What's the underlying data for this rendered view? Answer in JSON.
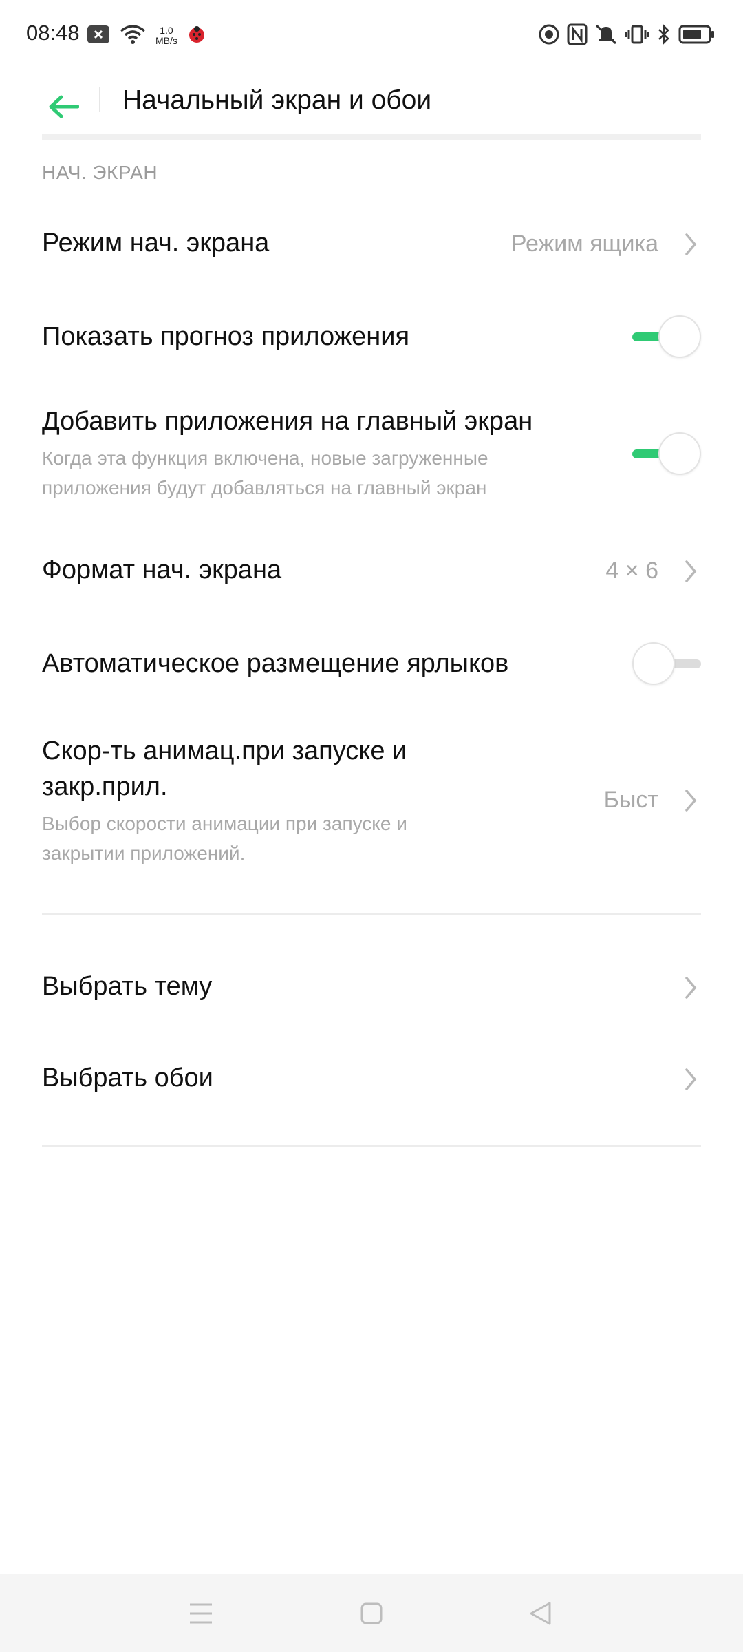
{
  "status_bar": {
    "time": "08:48",
    "speed_value": "1.0",
    "speed_unit": "MB/s"
  },
  "header": {
    "title": "Начальный экран и обои"
  },
  "section": {
    "home_screen": "НАЧ. ЭКРАН"
  },
  "rows": {
    "home_mode": {
      "title": "Режим нач. экрана",
      "value": "Режим ящика"
    },
    "app_prediction": {
      "title": "Показать прогноз приложения",
      "enabled": true
    },
    "add_apps": {
      "title": "Добавить приложения на главный экран",
      "subtitle_line1": "Когда эта функция включена, новые загруженные",
      "subtitle_line2": "приложения будут добавляться на главный экран",
      "enabled": true
    },
    "layout": {
      "title": "Формат нач. экрана",
      "value": "4 × 6"
    },
    "auto_shortcuts": {
      "title": "Автоматическое размещение ярлыков",
      "enabled": false
    },
    "animation": {
      "title_line1": "Скор-ть анимац.при запуске и",
      "title_line2": "закр.прил.",
      "subtitle_line1": "Выбор скорости анимации при запуске и",
      "subtitle_line2": "закрытии приложений.",
      "value": "Быст"
    },
    "theme": {
      "title": "Выбрать тему"
    },
    "wallpaper": {
      "title": "Выбрать обои"
    }
  },
  "colors": {
    "accent": "#2fca74",
    "secondary_text": "#a8a8a8",
    "nav_background": "#f5f5f5"
  }
}
